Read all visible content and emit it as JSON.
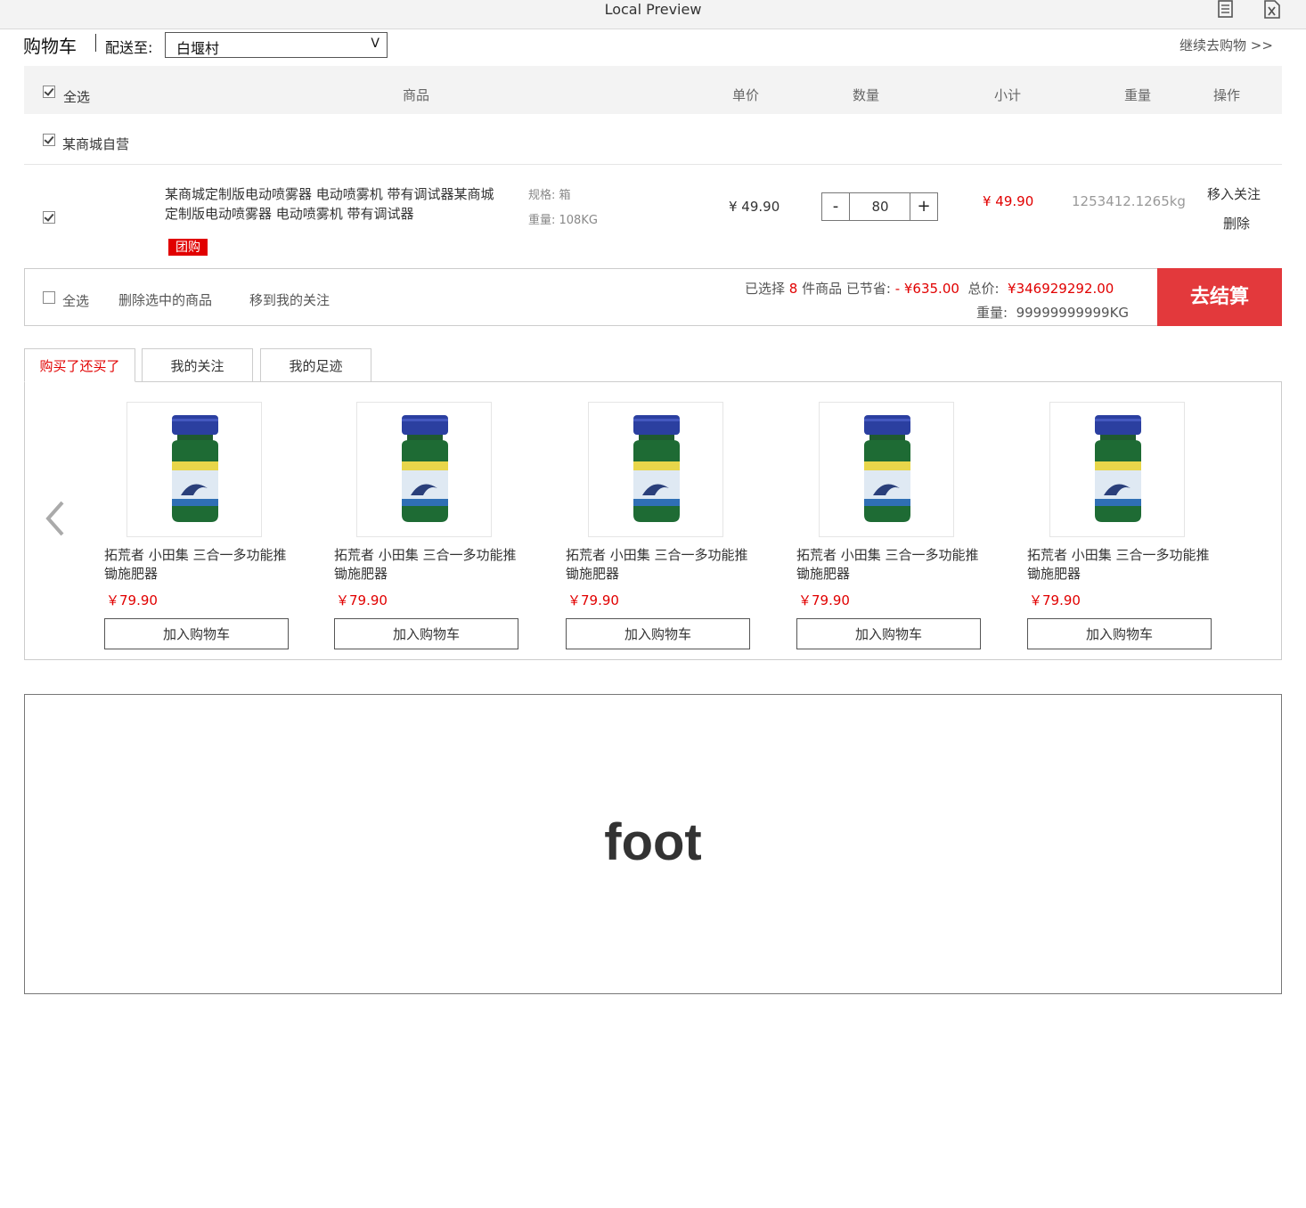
{
  "window": {
    "title": "Local Preview",
    "icons": [
      "document-icon",
      "excel-icon"
    ]
  },
  "header": {
    "cart_title": "购物车",
    "ship_label": "配送至:",
    "ship_value": "白堰村",
    "continue": "继续去购物 >>"
  },
  "table_header": {
    "select_all": "全选",
    "product": "商品",
    "unit_price": "单价",
    "quantity": "数量",
    "subtotal": "小计",
    "weight": "重量",
    "action": "操作"
  },
  "shop": {
    "name": "某商城自营",
    "checked": true
  },
  "item": {
    "checked": true,
    "name": "某商城定制版电动喷雾器 电动喷雾机 带有调试器某商城定制版电动喷雾器 电动喷雾机 带有调试器",
    "tag": "团购",
    "spec": "规格: 箱",
    "weight_spec": "重量: 108KG",
    "price": "¥ 49.90",
    "qty": "80",
    "minus": "-",
    "plus": "+",
    "subtotal": "¥ 49.90",
    "weight": "1253412.1265kg",
    "follow": "移入关注",
    "delete": "删除"
  },
  "footer_bar": {
    "select_all": "全选",
    "delete_selected": "删除选中的商品",
    "move_to_follow": "移到我的关注",
    "selected_prefix": "已选择 ",
    "selected_count": "8",
    "selected_suffix": " 件商品  已节省:",
    "saved": " - ¥635.00",
    "total_label": "  总价:  ",
    "total": "¥346929292.00",
    "weight_label": "重量:  ",
    "weight": "99999999999KG",
    "checkout": "去结算"
  },
  "tabs": [
    {
      "label": "购买了还买了",
      "active": true
    },
    {
      "label": "我的关注",
      "active": false
    },
    {
      "label": "我的足迹",
      "active": false
    }
  ],
  "recommend": [
    {
      "name": "拓荒者 小田集 三合一多功能推锄施肥器",
      "price": "￥79.90",
      "button": "加入购物车"
    },
    {
      "name": "拓荒者 小田集 三合一多功能推锄施肥器",
      "price": "￥79.90",
      "button": "加入购物车"
    },
    {
      "name": "拓荒者 小田集 三合一多功能推锄施肥器",
      "price": "￥79.90",
      "button": "加入购物车"
    },
    {
      "name": "拓荒者 小田集 三合一多功能推锄施肥器",
      "price": "￥79.90",
      "button": "加入购物车"
    },
    {
      "name": "拓荒者 小田集 三合一多功能推锄施肥器",
      "price": "￥79.90",
      "button": "加入购物车"
    }
  ],
  "footer": {
    "text": "foot"
  },
  "colors": {
    "accent": "#e10000",
    "checkout_bg": "#e3393c",
    "header_bg": "#f3f3f3"
  }
}
